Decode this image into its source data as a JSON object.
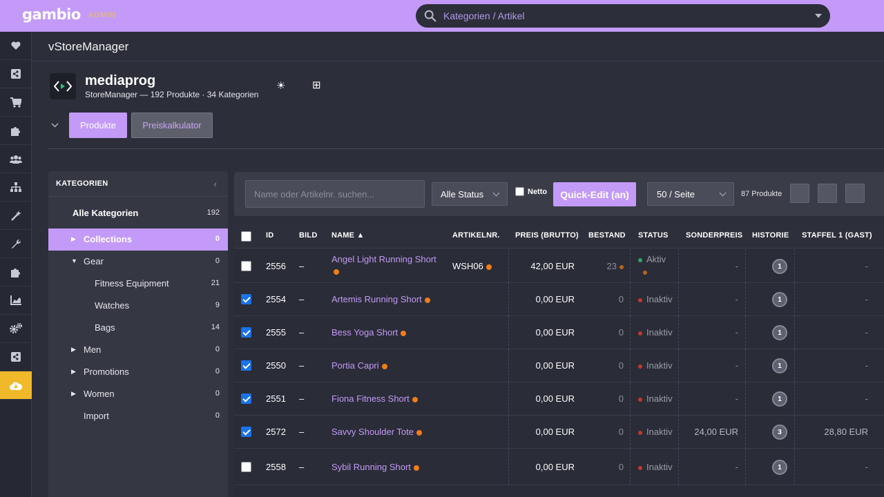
{
  "topbar": {
    "logo": "gambio",
    "admin_tag": "ADMIN",
    "search_placeholder": "Kategorien / Artikel"
  },
  "rail": {
    "items": [
      "heart-icon",
      "share-icon",
      "cart-icon",
      "puzzle-icon",
      "users-icon",
      "sitemap-icon",
      "magic-icon",
      "wrench-icon",
      "puzzle-icon",
      "chart-icon",
      "cogs-icon",
      "share-icon",
      "cloud-download-icon"
    ],
    "active_color": "#f0b92a"
  },
  "page": {
    "title": "vStoreManager",
    "app_name": "mediaprog",
    "app_subtitle": "StoreManager — 192 Produkte · 34 Kategorien",
    "tabs": {
      "products": "Produkte",
      "price_calc": "Preiskalkulator"
    }
  },
  "categories": {
    "header": "KATEGORIEN",
    "all": {
      "label": "Alle Kategorien",
      "count": "192"
    },
    "items": [
      {
        "label": "Collections",
        "count": "0",
        "arrow": "▶",
        "level": 0,
        "selected": true
      },
      {
        "label": "Gear",
        "count": "0",
        "arrow": "▼",
        "level": 0
      },
      {
        "label": "Fitness Equipment",
        "count": "21",
        "arrow": "",
        "level": 1
      },
      {
        "label": "Watches",
        "count": "9",
        "arrow": "",
        "level": 1
      },
      {
        "label": "Bags",
        "count": "14",
        "arrow": "",
        "level": 1
      },
      {
        "label": "Men",
        "count": "0",
        "arrow": "▶",
        "level": 0
      },
      {
        "label": "Promotions",
        "count": "0",
        "arrow": "▶",
        "level": 0
      },
      {
        "label": "Women",
        "count": "0",
        "arrow": "▶",
        "level": 0
      },
      {
        "label": "Import",
        "count": "0",
        "arrow": "",
        "level": 0
      }
    ]
  },
  "toolbar": {
    "search_placeholder": "Name oder Artikelnr. suchen...",
    "status_select": "Alle Status",
    "netto_label": "Netto",
    "quick_edit": "Quick-Edit (an)",
    "per_page": "50 / Seite",
    "product_count": "87 Produkte"
  },
  "table": {
    "columns": {
      "id": "ID",
      "image": "BILD",
      "name": "NAME ▲",
      "sku": "ARTIKELNR.",
      "price": "PREIS (BRUTTO)",
      "stock": "BESTAND",
      "status": "STATUS",
      "special": "SONDERPREIS",
      "history": "HISTORIE",
      "tier1": "STAFFEL 1 (GAST)"
    },
    "rows": [
      {
        "checked": false,
        "id": "2556",
        "image": "–",
        "name": "Angel Light Running Short",
        "sku": "WSH06",
        "price": "42,00 EUR",
        "stock": "23",
        "status": "Aktiv",
        "special": "-",
        "history": "1",
        "tier1": "-"
      },
      {
        "checked": true,
        "id": "2554",
        "image": "–",
        "name": "Artemis Running Short",
        "sku": "",
        "price": "0,00 EUR",
        "stock": "0",
        "status": "Inaktiv",
        "special": "-",
        "history": "1",
        "tier1": "-"
      },
      {
        "checked": true,
        "id": "2555",
        "image": "–",
        "name": "Bess Yoga Short",
        "sku": "",
        "price": "0,00 EUR",
        "stock": "0",
        "status": "Inaktiv",
        "special": "-",
        "history": "1",
        "tier1": "-"
      },
      {
        "checked": true,
        "id": "2550",
        "image": "–",
        "name": "Portia Capri",
        "sku": "",
        "price": "0,00 EUR",
        "stock": "0",
        "status": "Inaktiv",
        "special": "-",
        "history": "1",
        "tier1": "-"
      },
      {
        "checked": true,
        "id": "2551",
        "image": "–",
        "name": "Fiona Fitness Short",
        "sku": "",
        "price": "0,00 EUR",
        "stock": "0",
        "status": "Inaktiv",
        "special": "-",
        "history": "1",
        "tier1": "-"
      },
      {
        "checked": true,
        "id": "2572",
        "image": "–",
        "name": "Savvy Shoulder Tote",
        "sku": "",
        "price": "0,00 EUR",
        "stock": "0",
        "status": "Inaktiv",
        "special": "24,00 EUR",
        "history": "3",
        "tier1": "28,80 EUR"
      },
      {
        "checked": false,
        "id": "2558",
        "image": "–",
        "name": "Sybil Running Short",
        "sku": "",
        "price": "0,00 EUR",
        "stock": "0",
        "status": "Inaktiv",
        "special": "-",
        "history": "1",
        "tier1": "-"
      }
    ]
  },
  "colors": {
    "accent": "#c39af7",
    "active_status": "#2ea86b",
    "inactive_status": "#c0392b",
    "warning_dot": "#f07d1a",
    "checkbox": "#1a73e8"
  }
}
